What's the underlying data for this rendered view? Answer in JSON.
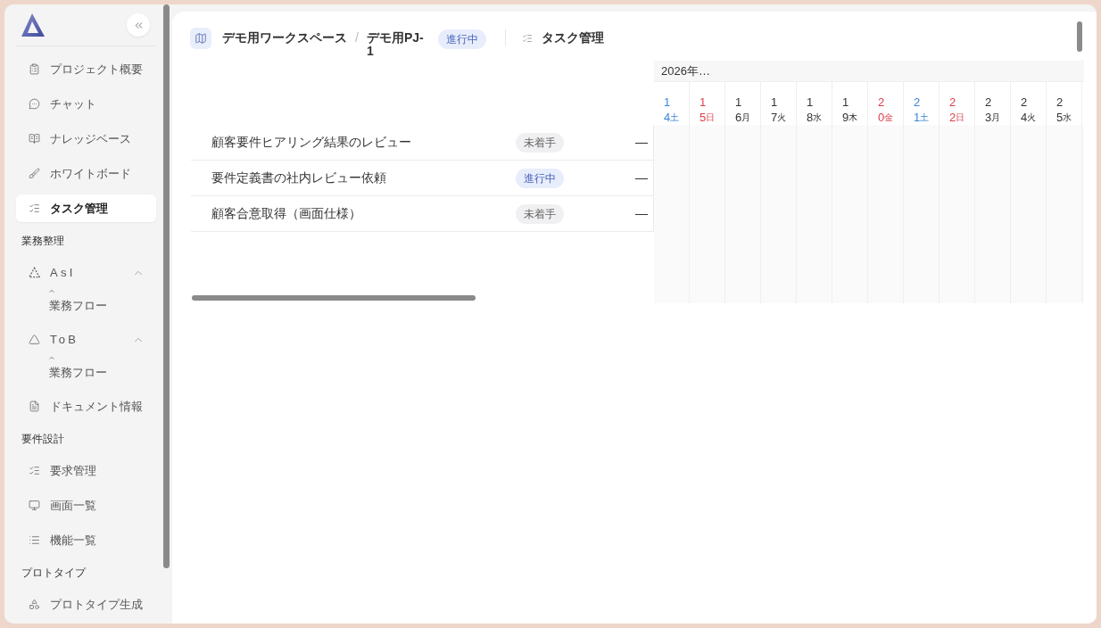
{
  "sidebar": {
    "sections": [
      {
        "items": [
          {
            "kind": "link",
            "label": "プロジェクト概要",
            "selected": false
          },
          {
            "kind": "link",
            "label": "チャット",
            "selected": false
          },
          {
            "kind": "link",
            "label": "ナレッジベース",
            "selected": false
          },
          {
            "kind": "link",
            "label": "ホワイトボード",
            "selected": false
          },
          {
            "kind": "link",
            "label": "タスク管理",
            "selected": true
          }
        ]
      },
      {
        "title": "業務整理",
        "items": [
          {
            "kind": "group",
            "label": "AsI",
            "expanded": true,
            "children": [
              {
                "label": "業務フロー",
                "selected": false
              }
            ]
          },
          {
            "kind": "group",
            "label": "ToB",
            "expanded": true,
            "children": [
              {
                "label": "業務フロー",
                "selected": false
              }
            ]
          },
          {
            "kind": "link",
            "label": "ドキュメント情報",
            "selected": false
          }
        ]
      },
      {
        "title": "要件設計",
        "items": [
          {
            "kind": "link",
            "label": "要求管理",
            "selected": false
          },
          {
            "kind": "link",
            "label": "画面一覧",
            "selected": false
          },
          {
            "kind": "link",
            "label": "機能一覧",
            "selected": false
          }
        ]
      },
      {
        "title": "プロトタイプ",
        "items": [
          {
            "kind": "link",
            "label": "プロトタイプ生成",
            "selected": false
          }
        ]
      }
    ]
  },
  "header": {
    "breadcrumb": [
      "デモ用ワークスペース",
      "デモ用PJ-1"
    ],
    "breadcrumb_separator": "/",
    "status": {
      "label": "進行中",
      "kind": "in_progress"
    },
    "page_title": "タスク管理"
  },
  "task_list": {
    "rows": [
      {
        "name": "顧客要件ヒアリング結果のレビュー",
        "status": {
          "label": "未着手",
          "kind": "not_started"
        },
        "column_3": "—"
      },
      {
        "name": "要件定義書の社内レビュー依頼",
        "status": {
          "label": "進行中",
          "kind": "in_progress"
        },
        "column_3": "—"
      },
      {
        "name": "顧客合意取得（画面仕様）",
        "status": {
          "label": "未着手",
          "kind": "not_started"
        },
        "column_3": "—"
      }
    ]
  },
  "gantt": {
    "month": "2026年…",
    "days": [
      {
        "day": "14",
        "weekday": "土",
        "kind": "saturday"
      },
      {
        "day": "15",
        "weekday": "日",
        "kind": "holiday"
      },
      {
        "day": "16",
        "weekday": "月",
        "kind": "weekday"
      },
      {
        "day": "17",
        "weekday": "火",
        "kind": "weekday"
      },
      {
        "day": "18",
        "weekday": "水",
        "kind": "weekday"
      },
      {
        "day": "19",
        "weekday": "木",
        "kind": "weekday"
      },
      {
        "day": "20",
        "weekday": "金",
        "kind": "holiday"
      },
      {
        "day": "21",
        "weekday": "土",
        "kind": "saturday"
      },
      {
        "day": "22",
        "weekday": "日",
        "kind": "holiday"
      },
      {
        "day": "23",
        "weekday": "月",
        "kind": "weekday"
      },
      {
        "day": "24",
        "weekday": "火",
        "kind": "weekday"
      },
      {
        "day": "25",
        "weekday": "水",
        "kind": "weekday"
      }
    ]
  }
}
